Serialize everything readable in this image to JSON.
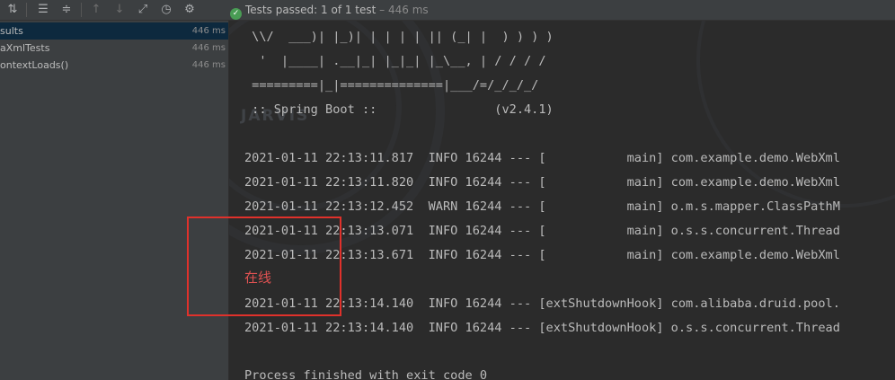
{
  "toolbar": {
    "icons": [
      "sort-icon",
      "expand-all-icon",
      "collapse-all-icon",
      "previous-failed-icon",
      "next-failed-icon",
      "export-icon",
      "history-icon",
      "settings-icon"
    ],
    "status_text": "Tests passed: ",
    "status_count": "1 of 1 test",
    "status_time": " – 446 ms"
  },
  "tree": {
    "items": [
      {
        "label": "sults",
        "time": "446 ms"
      },
      {
        "label": "aXmlTests",
        "time": "446 ms"
      },
      {
        "label": "ontextLoads()",
        "time": "446 ms"
      }
    ]
  },
  "console": {
    "banner": [
      " \\\\/  ___)| |_)| | | | | || (_| |  ) ) ) )",
      "  '  |____| .__|_| |_|_| |_\\__, | / / / /",
      " =========|_|==============|___/=/_/_/_/",
      " :: Spring Boot ::                (v2.4.1)"
    ],
    "logs": [
      "2021-01-11 22:13:11.817  INFO 16244 --- [           main] com.example.demo.WebXml",
      "2021-01-11 22:13:11.820  INFO 16244 --- [           main] com.example.demo.WebXml",
      "2021-01-11 22:13:12.452  WARN 16244 --- [           main] o.m.s.mapper.ClassPathM",
      "2021-01-11 22:13:13.071  INFO 16244 --- [           main] o.s.s.concurrent.Thread",
      "2021-01-11 22:13:13.671  INFO 16244 --- [           main] com.example.demo.WebXml"
    ],
    "annotation": "在线",
    "shutdown_logs": [
      "2021-01-11 22:13:14.140  INFO 16244 --- [extShutdownHook] com.alibaba.druid.pool.",
      "2021-01-11 22:13:14.140  INFO 16244 --- [extShutdownHook] o.s.s.concurrent.Thread"
    ],
    "exit_line": "Process finished with exit code 0",
    "watermark": "JARVIS"
  },
  "colors": {
    "accent_red": "#e0312b",
    "pass_green": "#499c54",
    "console_bg": "#2b2b2b"
  }
}
